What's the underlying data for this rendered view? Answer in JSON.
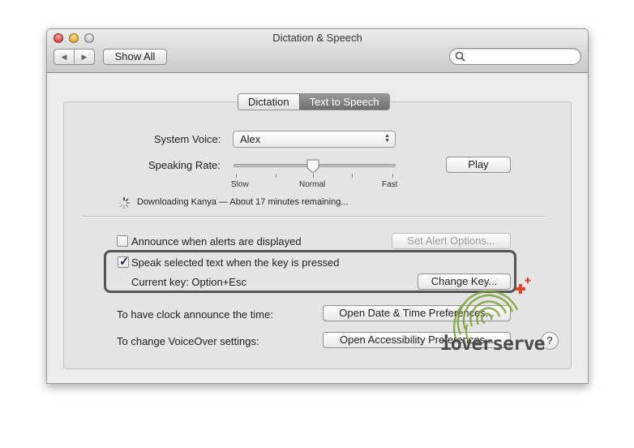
{
  "window": {
    "title": "Dictation & Speech"
  },
  "toolbar": {
    "back_label": "◀",
    "forward_label": "▶",
    "show_all_label": "Show All",
    "search_value": "",
    "search_placeholder": ""
  },
  "tabs": [
    {
      "label": "Dictation",
      "active": false
    },
    {
      "label": "Text to Speech",
      "active": true
    }
  ],
  "voice": {
    "label": "System Voice:",
    "value": "Alex"
  },
  "rate": {
    "label": "Speaking Rate:",
    "slow": "Slow",
    "normal": "Normal",
    "fast": "Fast",
    "level_fraction": 0.5
  },
  "play_label": "Play",
  "download_status": "Downloading Kanya — About 17 minutes remaining...",
  "alerts": {
    "label": "Announce when alerts are displayed",
    "checked": false,
    "options_label": "Set Alert Options..."
  },
  "speak": {
    "label": "Speak selected text when the key is pressed",
    "checked": true,
    "current_key_label": "Current key: Option+Esc",
    "change_key_label": "Change Key..."
  },
  "clock": {
    "label": "To have clock announce the time:",
    "button_label": "Open Date & Time Preferences..."
  },
  "voiceover": {
    "label": "To change VoiceOver settings:",
    "button_label": "Open Accessibility Preferences..."
  },
  "help_label": "?",
  "watermark": {
    "text": "ioverserve"
  },
  "colors": {
    "highlight_border": "#545454",
    "active_tab": "#7a7a7a",
    "watermark_green": "#7aa12f",
    "watermark_red": "#e0442a"
  }
}
